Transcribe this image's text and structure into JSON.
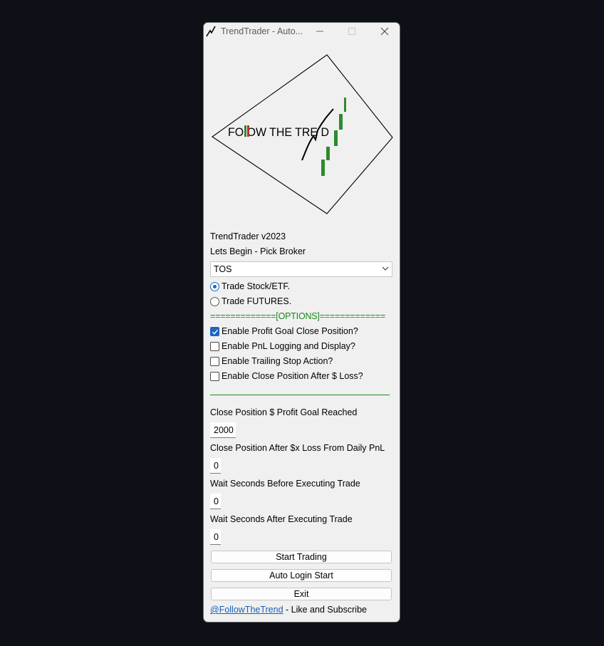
{
  "window": {
    "title": "TrendTrader - Auto..."
  },
  "logo": {
    "text": "FOLLOW THE TREND",
    "colors": {
      "green": "#2e8b2e",
      "red": "#c03030"
    }
  },
  "version_label": "TrendTrader v2023",
  "broker_prompt": "Lets Begin - Pick Broker",
  "broker_select": {
    "value": "TOS"
  },
  "trade_type": [
    {
      "label": "Trade Stock/ETF.",
      "selected": true
    },
    {
      "label": "Trade FUTURES.",
      "selected": false
    }
  ],
  "options_header": "=============[OPTIONS]=============",
  "options": [
    {
      "label": "Enable Profit Goal Close Position?",
      "checked": true
    },
    {
      "label": "Enable PnL Logging and Display?",
      "checked": false
    },
    {
      "label": "Enable Trailing Stop Action?",
      "checked": false
    },
    {
      "label": "Enable Close Position After $ Loss?",
      "checked": false
    }
  ],
  "fields": [
    {
      "label": "Close Position $ Profit Goal Reached",
      "value": "2000"
    },
    {
      "label": "Close Position After $x Loss From Daily PnL",
      "value": "0"
    },
    {
      "label": "Wait Seconds Before Executing Trade",
      "value": "0"
    },
    {
      "label": "Wait Seconds After Executing Trade",
      "value": "0"
    }
  ],
  "buttons": {
    "start": "Start Trading",
    "auto_login": "Auto Login Start",
    "exit": "Exit"
  },
  "footer": {
    "link": "@FollowTheTrend",
    "text": " - Like and Subscribe"
  },
  "colors": {
    "accent": "#1a67c2",
    "options_green": "#1a8a1a",
    "link": "#1a5fb4",
    "background": "#0d1117"
  }
}
